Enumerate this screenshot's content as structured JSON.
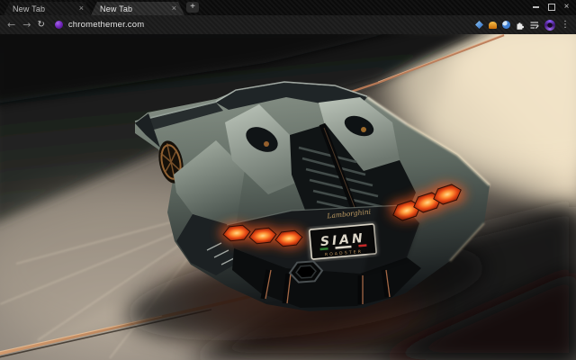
{
  "tabstrip": {
    "tabs": [
      {
        "label": "New Tab",
        "close_icon": "×"
      },
      {
        "label": "New Tab",
        "close_icon": "×"
      }
    ],
    "new_tab_icon": "+",
    "window_controls": {
      "close": "×"
    }
  },
  "toolbar": {
    "back_icon": "←",
    "forward_icon": "→",
    "reload_icon": "↻",
    "url": "chromethemer.com",
    "menu_icon": "⋮"
  },
  "wallpaper": {
    "brand_script": "Lamborghini",
    "plate_title": "SIAN",
    "plate_subtitle": "ROADSTER"
  },
  "colors": {
    "accent_copper": "#b4714b",
    "taillight_orange": "#ff6a1e",
    "beam_cream": "#f1e3c8",
    "theme_purple": "#7d3bd6"
  }
}
